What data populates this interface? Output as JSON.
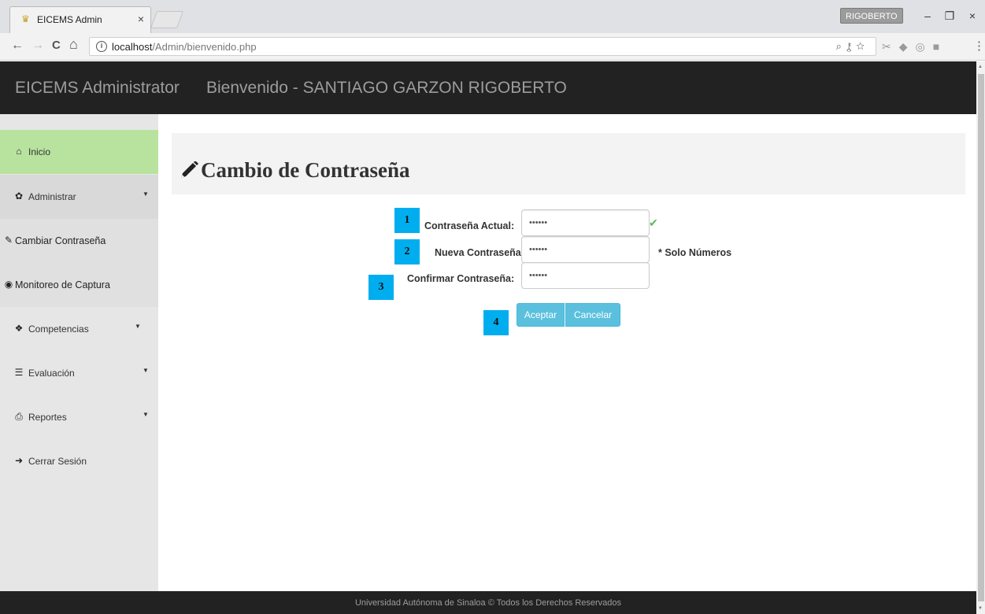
{
  "browser": {
    "tab_title": "EICEMS Admin",
    "tab_close": "×",
    "profile_name": "RIGOBERTO",
    "url_host": "localhost",
    "url_path": "/Admin/bienvenido.php",
    "icons": {
      "back": "←",
      "forward": "→",
      "reload": "C",
      "home": "⌂",
      "minimize": "–",
      "maximize": "❐",
      "close": "×",
      "zoom": "⌕",
      "key": "⚷",
      "star": "☆",
      "menu": "⋮",
      "info": "i"
    }
  },
  "header": {
    "brand": "EICEMS Administrator",
    "welcome": "Bienvenido - SANTIAGO GARZON RIGOBERTO"
  },
  "sidebar": {
    "items": [
      {
        "label": "Inicio",
        "icon": "home-icon",
        "glyph": "⌂",
        "caret": ""
      },
      {
        "label": "Administrar",
        "icon": "gear-icon",
        "glyph": "✿",
        "caret": "▼"
      },
      {
        "label": "Cambiar Contraseña",
        "icon": "pencil-icon",
        "glyph": "✎",
        "caret": ""
      },
      {
        "label": "Monitoreo de Captura",
        "icon": "eye-icon",
        "glyph": "◉",
        "caret": ""
      },
      {
        "label": "Competencias",
        "icon": "cubes-icon",
        "glyph": "❖",
        "caret": "▼"
      },
      {
        "label": "Evaluación",
        "icon": "list-icon",
        "glyph": "☰",
        "caret": "▼"
      },
      {
        "label": "Reportes",
        "icon": "print-icon",
        "glyph": "⎙",
        "caret": "▼"
      },
      {
        "label": "Cerrar Sesión",
        "icon": "signout-icon",
        "glyph": "➜",
        "caret": ""
      }
    ]
  },
  "main": {
    "title": "Cambio de Contraseña",
    "form": {
      "current_label": "Contraseña Actual:",
      "current_value": "••••••",
      "new_label": "Nueva Contraseña:",
      "new_value": "••••••",
      "new_hint": "* Solo Números",
      "confirm_label": "Confirmar Contraseña:",
      "confirm_value": "••••••",
      "valid_mark": "✔"
    },
    "buttons": {
      "accept": "Aceptar",
      "cancel": "Cancelar"
    },
    "steps": [
      "1",
      "2",
      "3",
      "4"
    ]
  },
  "footer": {
    "text": "Universidad Autónoma de Sinaloa © Todos los Derechos Reservados"
  },
  "colors": {
    "header_bg": "#222222",
    "sidebar_active": "#b8e39e",
    "button_info": "#5bc0de",
    "step_badge": "#00aeef",
    "valid_check": "#5cb85c"
  }
}
